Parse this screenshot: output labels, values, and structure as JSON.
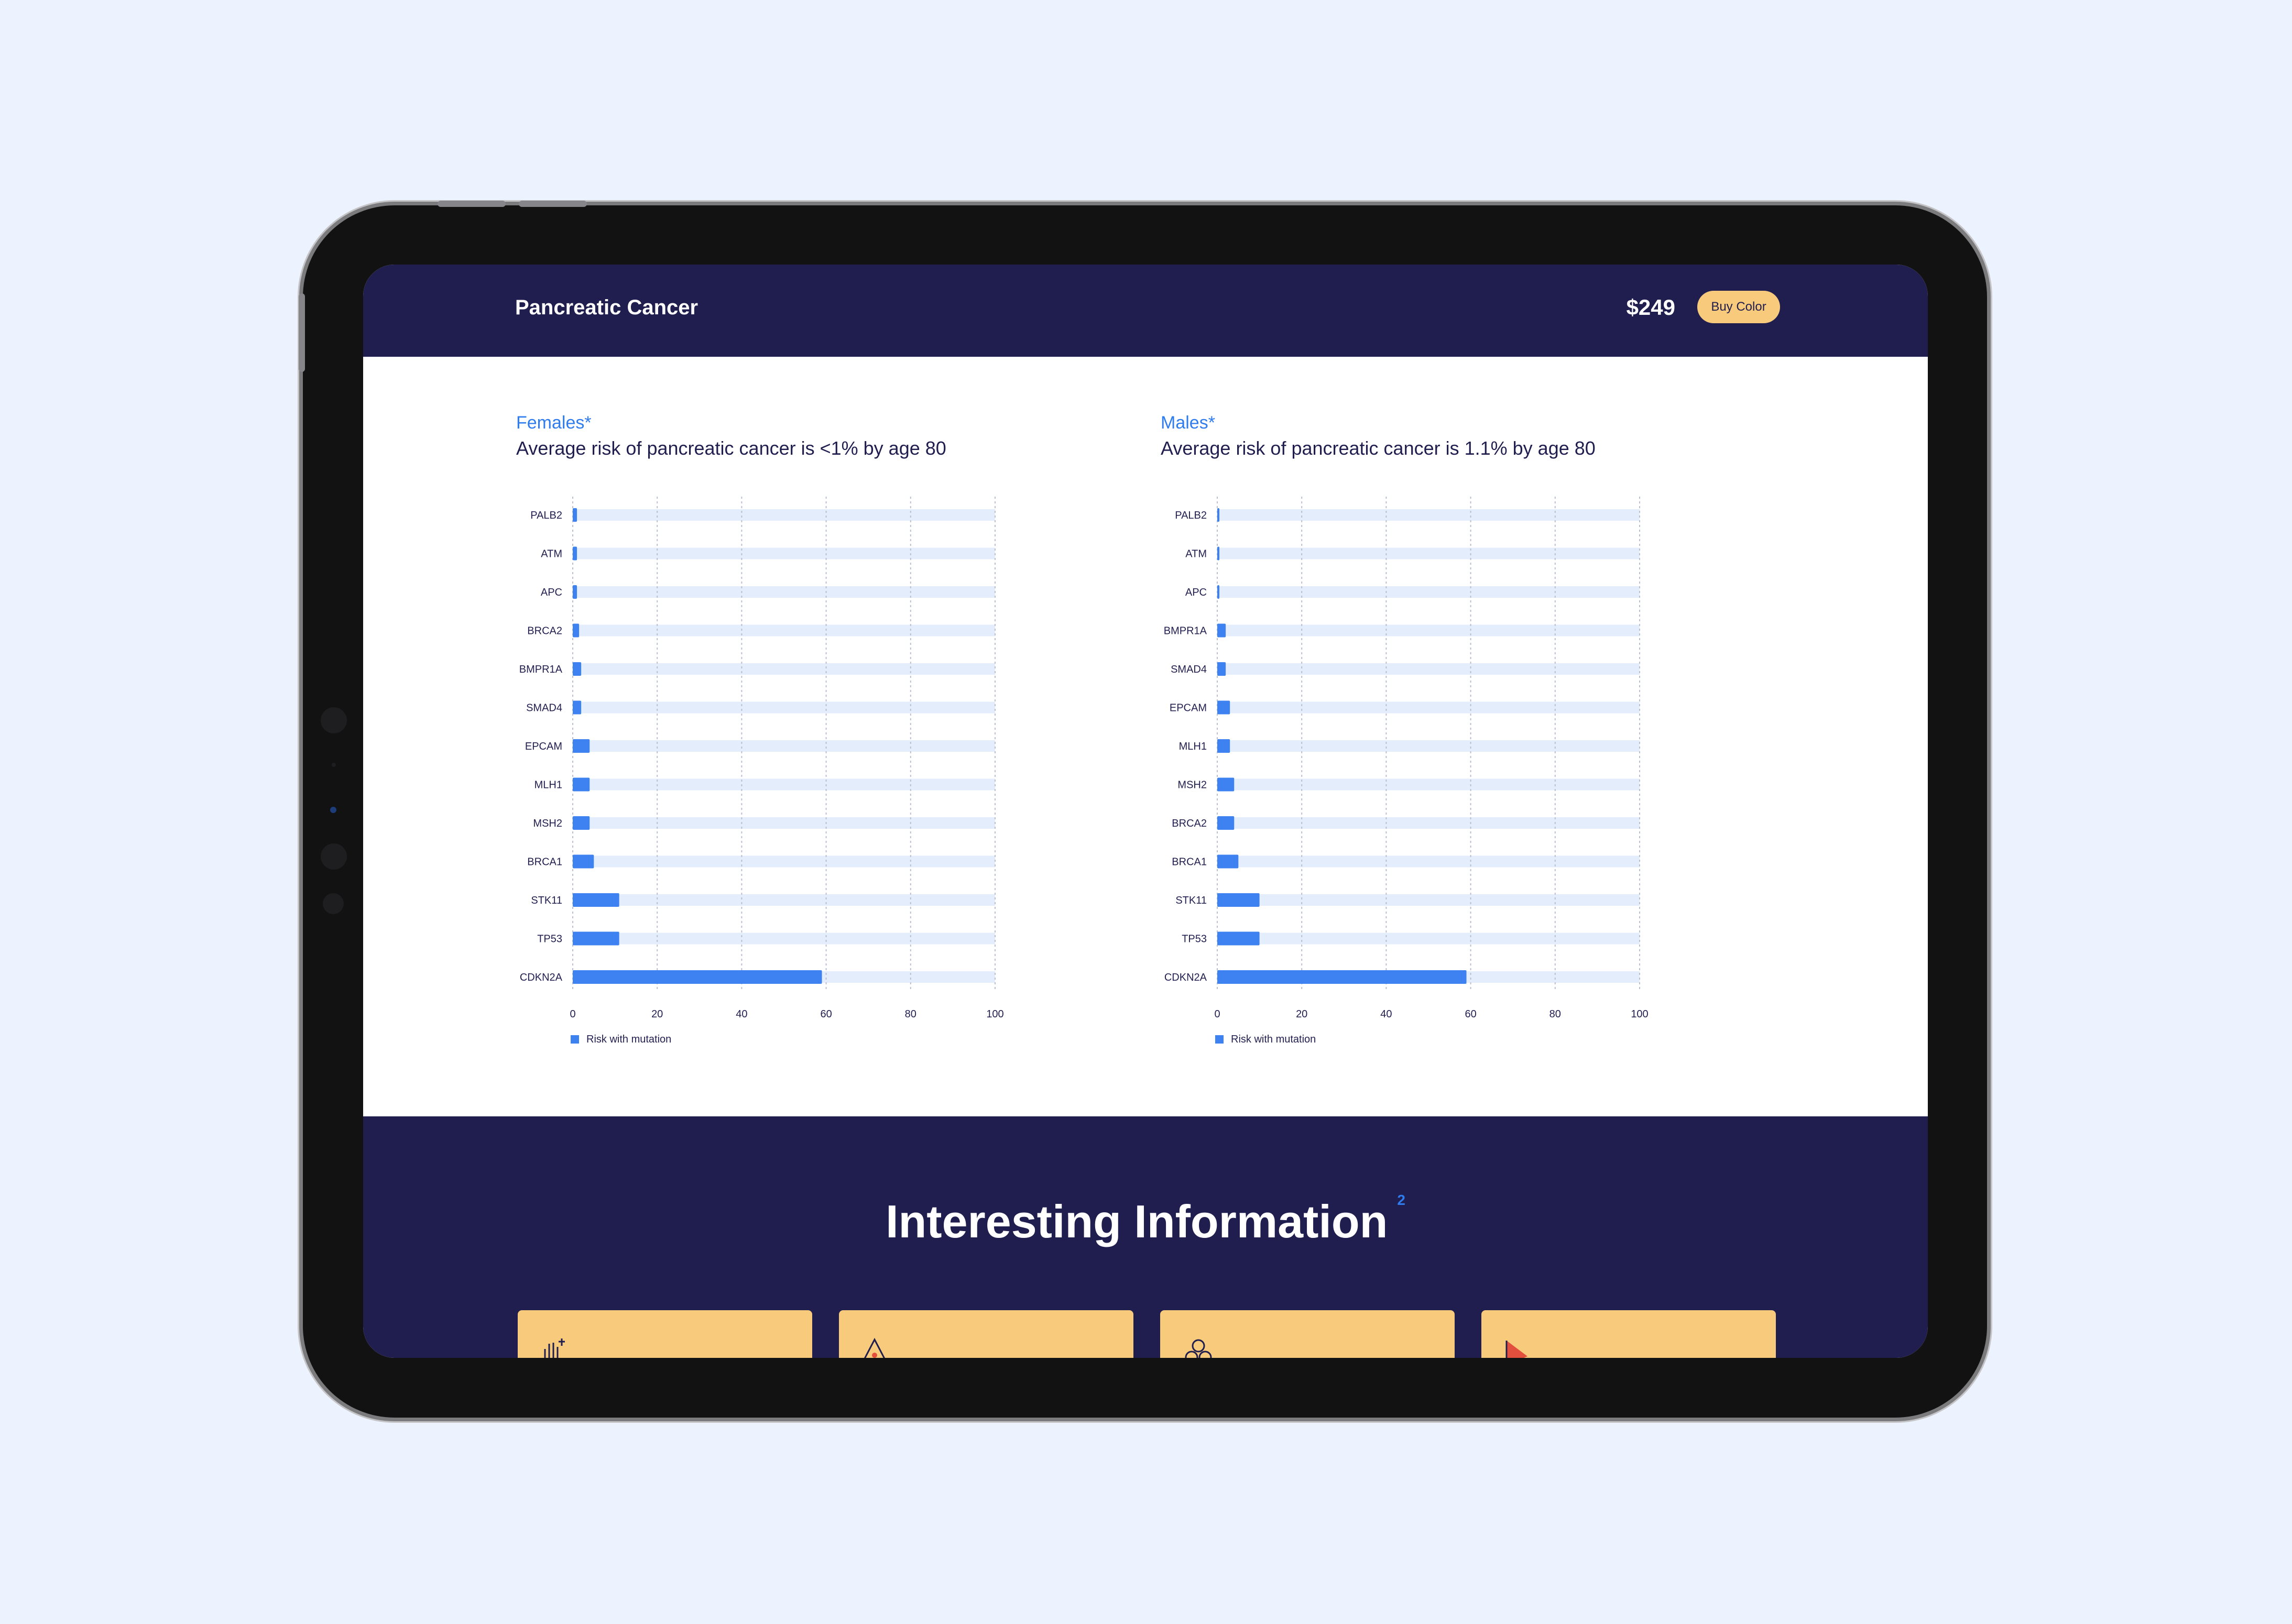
{
  "header": {
    "title": "Pancreatic Cancer",
    "price": "$249",
    "buy_label": "Buy Color"
  },
  "charts": [
    {
      "heading": "Females*",
      "subtitle": "Average risk of pancreatic cancer is <1% by age 80",
      "legend": "Risk with mutation"
    },
    {
      "heading": "Males*",
      "subtitle": "Average risk of pancreatic cancer is 1.1% by age 80",
      "legend": "Risk with mutation"
    }
  ],
  "chart_data": [
    {
      "type": "bar",
      "orientation": "horizontal",
      "categories": [
        "PALB2",
        "ATM",
        "APC",
        "BRCA2",
        "BMPR1A",
        "SMAD4",
        "EPCAM",
        "MLH1",
        "MSH2",
        "BRCA1",
        "STK11",
        "TP53",
        "CDKN2A"
      ],
      "series": [
        {
          "name": "Risk with mutation",
          "values": [
            1,
            1,
            1,
            1.5,
            2,
            2,
            4,
            4,
            4,
            5,
            11,
            11,
            59
          ]
        }
      ],
      "x_ticks": [
        0,
        20,
        40,
        60,
        80,
        100
      ],
      "xlim": [
        0,
        100
      ],
      "grid": true,
      "legend_position": "bottom-left",
      "colors": {
        "bar": "#3d82f0",
        "track": "#e3edfc",
        "grid": "#b8bfd0"
      }
    },
    {
      "type": "bar",
      "orientation": "horizontal",
      "categories": [
        "PALB2",
        "ATM",
        "APC",
        "BMPR1A",
        "SMAD4",
        "EPCAM",
        "MLH1",
        "MSH2",
        "BRCA2",
        "BRCA1",
        "STK11",
        "TP53",
        "CDKN2A"
      ],
      "series": [
        {
          "name": "Risk with mutation",
          "values": [
            0.5,
            0.5,
            0.5,
            2,
            2,
            3,
            3,
            4,
            4,
            5,
            10,
            10,
            59
          ]
        }
      ],
      "x_ticks": [
        0,
        20,
        40,
        60,
        80,
        100
      ],
      "xlim": [
        0,
        100
      ],
      "grid": true,
      "legend_position": "bottom-left",
      "colors": {
        "bar": "#3d82f0",
        "track": "#e3edfc",
        "grid": "#b8bfd0"
      }
    }
  ],
  "info": {
    "title": "Interesting Information",
    "superscript": "2",
    "cards": [
      {
        "icon": "hand-icon"
      },
      {
        "icon": "warning-triangle-icon"
      },
      {
        "icon": "people-icon"
      },
      {
        "icon": "flag-icon"
      }
    ]
  },
  "colors": {
    "page_bg": "#ecf3fe",
    "navy": "#201e4f",
    "accent_blue": "#2f7cef",
    "button_yellow": "#f8ca7c"
  }
}
